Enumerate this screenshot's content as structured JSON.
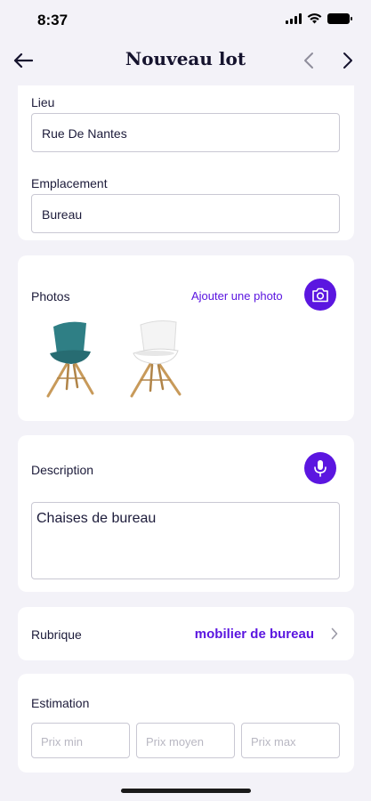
{
  "status_bar": {
    "time": "8:37",
    "icons": [
      "signal-icon",
      "wifi-icon",
      "battery-icon"
    ]
  },
  "nav": {
    "title": "Nouveau lot",
    "back_icon": "arrow-left-icon",
    "prev_icon": "chevron-left-icon",
    "next_icon": "chevron-right-icon"
  },
  "location_card": {
    "lieu_label": "Lieu",
    "lieu_value": "Rue De Nantes",
    "emplacement_label": "Emplacement",
    "emplacement_value": "Bureau"
  },
  "photos_card": {
    "label": "Photos",
    "add_link": "Ajouter une photo",
    "camera_icon": "camera-icon",
    "photos": [
      {
        "subject": "teal-chair",
        "color": "#2f7f85"
      },
      {
        "subject": "white-chair",
        "color": "#f1f1f1"
      }
    ]
  },
  "description_card": {
    "label": "Description",
    "mic_icon": "microphone-icon",
    "value": "Chaises de bureau"
  },
  "rubrique_card": {
    "label": "Rubrique",
    "value": "mobilier de bureau",
    "chevron_icon": "chevron-right-icon"
  },
  "estimation_card": {
    "label": "Estimation",
    "placeholders": [
      "Prix min",
      "Prix moyen",
      "Prix max"
    ]
  },
  "colors": {
    "accent": "#5b16e0",
    "background": "#f3f2f8",
    "text": "#1c1b3a",
    "border": "#c9c8d3"
  }
}
